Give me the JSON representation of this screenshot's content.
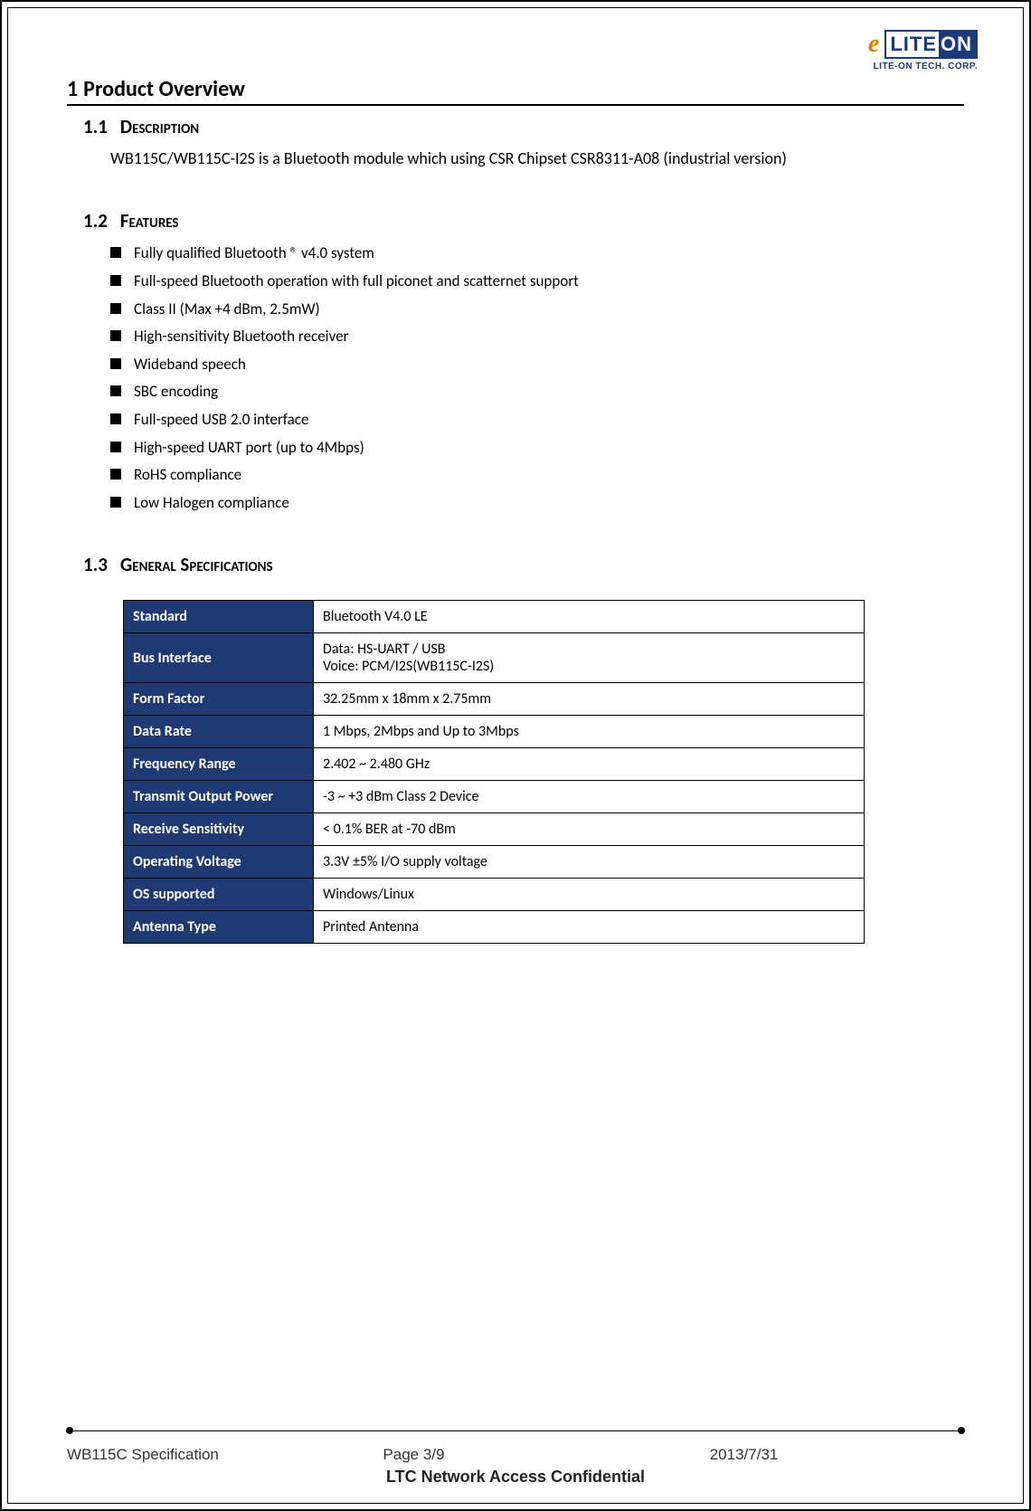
{
  "logo": {
    "e_mark": "e",
    "lite": "LITE",
    "on": "ON",
    "sub": "LITE-ON TECH. CORP."
  },
  "section1": {
    "num": "1",
    "title": "Product Overview"
  },
  "section11": {
    "num": "1.1",
    "title": "Description",
    "body": "WB115C/WB115C-I2S is a Bluetooth module which using CSR Chipset CSR8311-A08 (industrial version)"
  },
  "section12": {
    "num": "1.2",
    "title": "Features",
    "items": [
      "Fully qualified Bluetooth ® v4.0 system",
      "Full-speed Bluetooth operation with full piconet and scatternet support",
      "Class II (Max +4 dBm, 2.5mW)",
      "High-sensitivity Bluetooth receiver",
      "Wideband speech",
      "SBC encoding",
      "Full-speed USB 2.0 interface",
      "High-speed UART port (up to 4Mbps)",
      "RoHS compliance",
      "Low Halogen compliance"
    ]
  },
  "section13": {
    "num": "1.3",
    "title": "General Specifications",
    "rows": [
      {
        "k": "Standard",
        "v": "Bluetooth V4.0 LE"
      },
      {
        "k": "Bus Interface",
        "v": "Data: HS-UART / USB\nVoice: PCM/I2S(WB115C-I2S)"
      },
      {
        "k": "Form Factor",
        "v": "32.25mm x 18mm x 2.75mm"
      },
      {
        "k": "Data Rate",
        "v": "1 Mbps, 2Mbps and Up to 3Mbps"
      },
      {
        "k": "Frequency Range",
        "v": "2.402 ~ 2.480 GHz"
      },
      {
        "k": "Transmit Output Power",
        "v": "-3 ~ +3 dBm Class 2 Device"
      },
      {
        "k": "Receive Sensitivity",
        "v": "< 0.1% BER at -70 dBm"
      },
      {
        "k": "Operating Voltage",
        "v": "3.3V ±5% I/O supply voltage"
      },
      {
        "k": "OS supported",
        "v": "Windows/Linux"
      },
      {
        "k": "Antenna Type",
        "v": "Printed Antenna"
      }
    ]
  },
  "footer": {
    "doc": "WB115C Specification",
    "page": "Page 3/9",
    "date": "2013/7/31",
    "conf": "LTC Network Access Confidential"
  }
}
